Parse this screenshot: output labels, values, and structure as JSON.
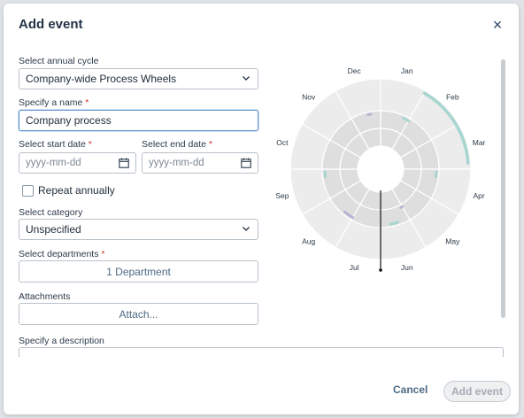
{
  "dialog": {
    "title": "Add event",
    "close_label": "×"
  },
  "form": {
    "annual_cycle": {
      "label": "Select annual cycle",
      "value": "Company-wide Process Wheels"
    },
    "name": {
      "label": "Specify a name",
      "required_mark": "*",
      "value": "Company process"
    },
    "start_date": {
      "label": "Select start date",
      "required_mark": "*",
      "placeholder": "yyyy-mm-dd"
    },
    "end_date": {
      "label": "Select end date",
      "required_mark": "*",
      "placeholder": "yyyy-mm-dd"
    },
    "repeat": {
      "label": "Repeat annually",
      "checked": false
    },
    "category": {
      "label": "Select category",
      "value": "Unspecified"
    },
    "departments": {
      "label": "Select departments",
      "required_mark": "*",
      "button": "1 Department"
    },
    "attachments": {
      "label": "Attachments",
      "button": "Attach..."
    },
    "description": {
      "label": "Specify a description"
    }
  },
  "wheel": {
    "months": [
      "Jan",
      "Feb",
      "Mar",
      "Apr",
      "May",
      "Jun",
      "Jul",
      "Aug",
      "Sep",
      "Oct",
      "Nov",
      "Dec"
    ],
    "colors": {
      "ring_outer": "#ececec",
      "ring_inner": "#dedede",
      "teal": "#a7d6d1",
      "purple": "#b9b3d6",
      "needle": "#111111"
    }
  },
  "footer": {
    "cancel_label": "Cancel",
    "add_label": "Add event"
  },
  "icons": {
    "chevron": "chevron-down-icon",
    "calendar": "calendar-icon",
    "close": "close-icon"
  }
}
